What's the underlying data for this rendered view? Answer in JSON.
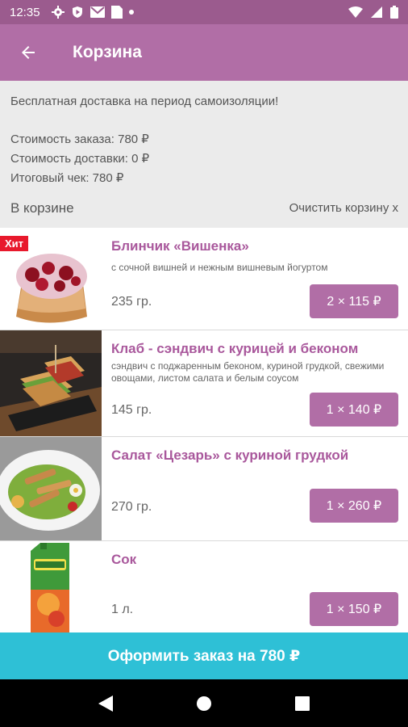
{
  "status": {
    "time": "12:35"
  },
  "appbar": {
    "title": "Корзина"
  },
  "info": {
    "promo": "Бесплатная доставка на период самоизоляции!",
    "order_cost": "Стоимость заказа: 780 ₽",
    "delivery_cost": "Стоимость доставки: 0 ₽",
    "total": "Итоговый чек: 780 ₽",
    "in_cart": "В корзине",
    "clear_cart": "Очистить корзину x"
  },
  "items": [
    {
      "name": "Блинчик «Вишенка»",
      "desc": "с сочной вишней и нежным вишневым йогуртом",
      "weight": "235 гр.",
      "qty": "2 × 115 ₽",
      "badge": "Хит"
    },
    {
      "name": "Клаб - сэндвич с курицей и беконом",
      "desc": "сэндвич с поджаренным беконом, куриной грудкой, свежими овощами, листом салата и белым соусом",
      "weight": "145 гр.",
      "qty": "1 × 140 ₽"
    },
    {
      "name": "Салат «Цезарь» с куриной грудкой",
      "desc": "",
      "weight": "270 гр.",
      "qty": "1 × 260 ₽"
    },
    {
      "name": "Сок",
      "desc": "",
      "weight": "1 л.",
      "qty": "1 × 150 ₽"
    }
  ],
  "order_button": "Оформить заказ на 780 ₽",
  "colors": {
    "primary": "#b16ea6",
    "status_bar": "#9b5b8e",
    "accent": "#2ec0d6",
    "hit_badge": "#e8192c"
  }
}
